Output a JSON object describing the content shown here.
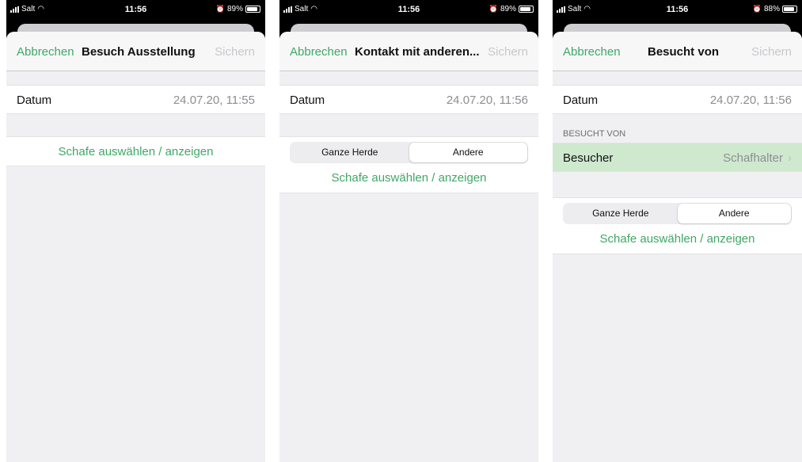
{
  "screens": [
    {
      "status": {
        "carrier": "Salt",
        "time": "11:56",
        "battery": "89%",
        "battery_level": 0.89
      },
      "nav": {
        "cancel": "Abbrechen",
        "title": "Besuch Ausstellung",
        "save": "Sichern"
      },
      "date_row": {
        "label": "Datum",
        "value": "24.07.20, 11:55"
      },
      "select_link": "Schafe auswählen / anzeigen"
    },
    {
      "status": {
        "carrier": "Salt",
        "time": "11:56",
        "battery": "89%",
        "battery_level": 0.89
      },
      "nav": {
        "cancel": "Abbrechen",
        "title": "Kontakt mit anderen...",
        "save": "Sichern"
      },
      "date_row": {
        "label": "Datum",
        "value": "24.07.20, 11:56"
      },
      "segments": {
        "options": [
          "Ganze Herde",
          "Andere"
        ],
        "selected": "Andere"
      },
      "select_link": "Schafe auswählen / anzeigen"
    },
    {
      "status": {
        "carrier": "Salt",
        "time": "11:56",
        "battery": "88%",
        "battery_level": 0.88
      },
      "nav": {
        "cancel": "Abbrechen",
        "title": "Besucht von",
        "save": "Sichern"
      },
      "date_row": {
        "label": "Datum",
        "value": "24.07.20, 11:56"
      },
      "section_header": "BESUCHT VON",
      "visitor_row": {
        "label": "Besucher",
        "value": "Schafhalter"
      },
      "segments": {
        "options": [
          "Ganze Herde",
          "Andere"
        ],
        "selected": "Andere"
      },
      "select_link": "Schafe auswählen / anzeigen"
    }
  ],
  "icons": {
    "wifi": "wifi-icon",
    "alarm": "alarm-icon",
    "chevron": "chevron-right-icon"
  },
  "colors": {
    "accent": "#3fa866",
    "highlight_row": "#cfe9cf",
    "disabled": "#c8c8cc"
  }
}
